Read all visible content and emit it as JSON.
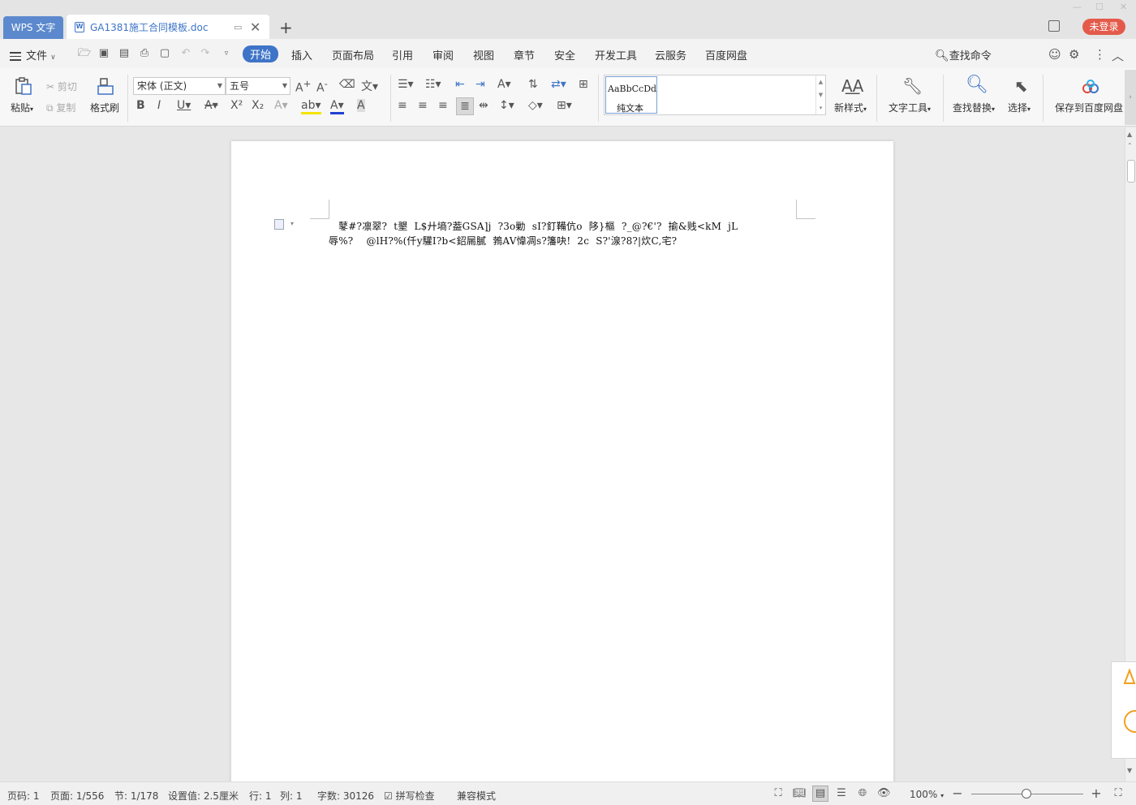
{
  "titlebar": {
    "app_tab": "WPS 文字",
    "doc_tab": "GA1381施工合同模板.doc",
    "login": "未登录"
  },
  "menubar": {
    "file": "文件",
    "tabs": [
      "开始",
      "插入",
      "页面布局",
      "引用",
      "审阅",
      "视图",
      "章节",
      "安全",
      "开发工具",
      "云服务",
      "百度网盘"
    ],
    "search": "查找命令"
  },
  "ribbon": {
    "paste": "粘贴",
    "cut": "剪切",
    "copy": "复制",
    "format_painter": "格式刷",
    "font_name": "宋体 (正文)",
    "font_size": "五号",
    "style_sample": "AaBbCcDd",
    "style_name": "纯文本",
    "new_style": "新样式",
    "text_tools": "文字工具",
    "find_replace": "查找替换",
    "select": "选择",
    "save_baidu": "保存到百度网盘"
  },
  "document": {
    "lines": [
      "   鼕#?凛翠?  t墾  L$廾墒?葢GSA]j  ?3o勦  sI?釘鞴伉o  陊}樞  ?_@?€'?  揄&贱<kM  jL",
      "辱%?    @lH?%(仟y驩I?b<鉊屚膩  鵓AV愇凋s?籓吷!  2c  S?'湶?8?|炊C,宅?"
    ]
  },
  "statusbar": {
    "page_code": "页码: 1",
    "page": "页面: 1/556",
    "section": "节: 1/178",
    "setting": "设置值: 2.5厘米",
    "row": "行: 1",
    "col": "列: 1",
    "word_count": "字数: 30126",
    "spell_check": "拼写检查",
    "compat_mode": "兼容模式",
    "zoom": "100%"
  },
  "colors": {
    "accent": "#3e74c8",
    "login_red": "#e45a4a",
    "app_tab": "#5c89cd"
  }
}
